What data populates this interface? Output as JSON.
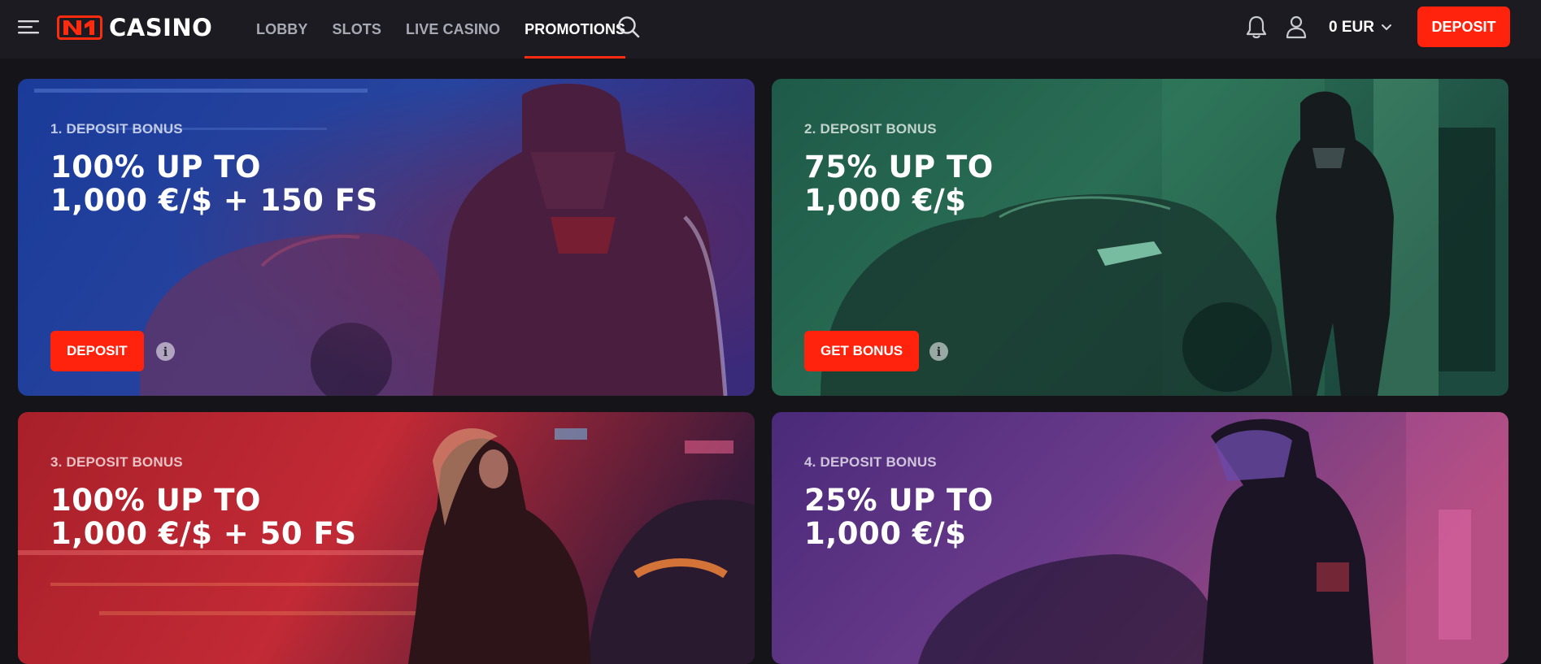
{
  "header": {
    "brand": "CASINO",
    "nav": [
      {
        "label": "LOBBY",
        "active": false
      },
      {
        "label": "SLOTS",
        "active": false
      },
      {
        "label": "LIVE CASINO",
        "active": false
      },
      {
        "label": "PROMOTIONS",
        "active": true
      }
    ],
    "balance": "0 EUR",
    "deposit_label": "DEPOSIT",
    "icons": [
      "menu-icon",
      "n1-logo",
      "search-icon",
      "bell-icon",
      "user-icon",
      "chevron-down-icon"
    ]
  },
  "colors": {
    "accent": "#ff230d",
    "background": "#141419",
    "header": "#1b1b21"
  },
  "promotions": [
    {
      "label": "1. DEPOSIT BONUS",
      "title_line1": "100% UP TO",
      "title_line2": "1,000 €/$ + 150 FS",
      "button": "DEPOSIT",
      "theme": "blue"
    },
    {
      "label": "2. DEPOSIT BONUS",
      "title_line1": "75% UP TO",
      "title_line2": "1,000 €/$",
      "button": "GET BONUS",
      "theme": "green"
    },
    {
      "label": "3. DEPOSIT BONUS",
      "title_line1": "100% UP TO",
      "title_line2": "1,000 €/$ + 50 FS",
      "theme": "red"
    },
    {
      "label": "4. DEPOSIT BONUS",
      "title_line1": "25% UP TO",
      "title_line2": "1,000 €/$",
      "theme": "purple"
    }
  ]
}
